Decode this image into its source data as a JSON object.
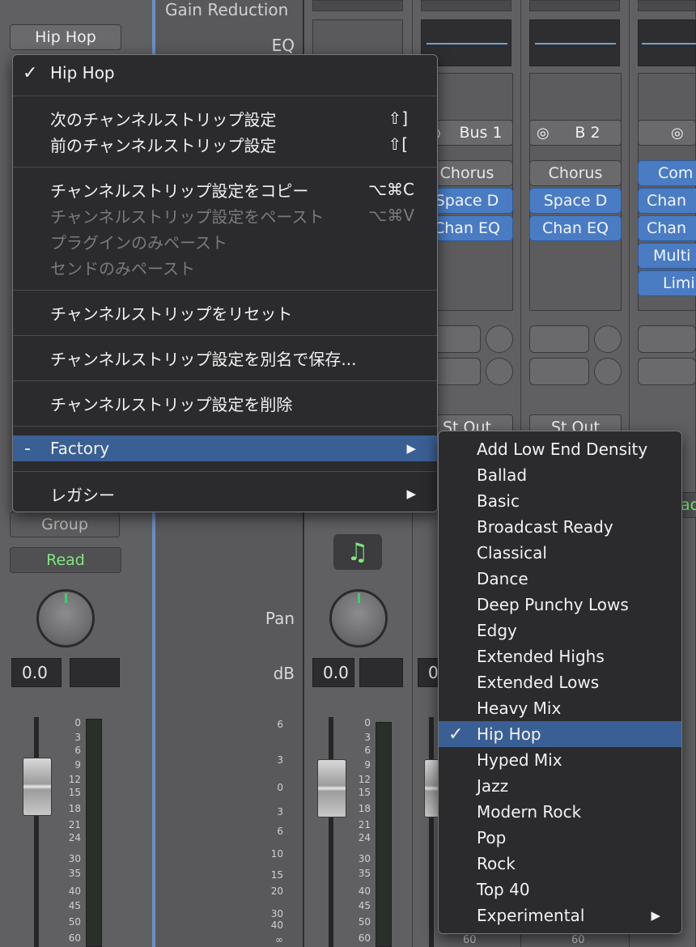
{
  "mixer": {
    "channel_preset": "Hip Hop",
    "labels": {
      "gain_reduction": "Gain Reduction",
      "eq": "EQ",
      "pan": "Pan",
      "db": "dB",
      "group": "Group",
      "read": "Read"
    },
    "strips": [
      {
        "id": "s1",
        "pan_value": "0.0"
      },
      {
        "id": "s2",
        "pan_value": "0.0"
      },
      {
        "id": "s3",
        "pan_value": "0"
      }
    ],
    "io": {
      "bus1": "Bus 1",
      "b2": "B 2",
      "st_out_1": "St Out",
      "st_out_2": "St Out"
    },
    "slots_c1": [
      "Chorus",
      "Space D",
      "Chan EQ"
    ],
    "slots_c2": [
      "Chorus",
      "Space D",
      "Chan EQ"
    ],
    "slots_c3": [
      "Com",
      "Chan",
      "Chan",
      "Multi",
      "Limi"
    ],
    "read_partial": "ad",
    "scale_left": [
      "0",
      "3",
      "6",
      "9",
      "12",
      "15",
      "18",
      "21",
      "24",
      "30",
      "35",
      "40",
      "45",
      "50",
      "60"
    ],
    "scale_mid_left": [
      "6",
      "3",
      "0",
      "3",
      "6",
      "10",
      "15",
      "20",
      "30",
      "40",
      "∞"
    ],
    "scale_mid_right": [
      "0",
      "3",
      "6",
      "9",
      "12",
      "15",
      "18",
      "21",
      "24",
      "30",
      "35",
      "40",
      "45",
      "50",
      "60"
    ],
    "scale_bottom": [
      "60",
      "60"
    ]
  },
  "context_menu": {
    "header": {
      "check": "✓",
      "label": "Hip Hop"
    },
    "items": [
      {
        "label": "次のチャンネルストリップ設定",
        "shortcut": "⇧]"
      },
      {
        "label": "前のチャンネルストリップ設定",
        "shortcut": "⇧["
      },
      {
        "label": "チャンネルストリップ設定をコピー",
        "shortcut": "⌥⌘C"
      },
      {
        "label": "チャンネルストリップ設定をペースト",
        "shortcut": "⌥⌘V",
        "disabled": true
      },
      {
        "label": "プラグインのみペースト",
        "disabled": true
      },
      {
        "label": "センドのみペースト",
        "disabled": true
      },
      {
        "label": "チャンネルストリップをリセット"
      },
      {
        "label": "チャンネルストリップ設定を別名で保存..."
      },
      {
        "label": "チャンネルストリップ設定を削除"
      },
      {
        "label": "Factory",
        "prefix": "-",
        "arrow": "▶",
        "highlighted": true
      },
      {
        "label": "レガシー",
        "arrow": "▶"
      }
    ]
  },
  "factory_submenu": {
    "items": [
      "Add Low End Density",
      "Ballad",
      "Basic",
      "Broadcast Ready",
      "Classical",
      "Dance",
      "Deep Punchy Lows",
      "Edgy",
      "Extended Highs",
      "Extended Lows",
      "Heavy Mix",
      "Hip Hop",
      "Hyped Mix",
      "Jazz",
      "Modern Rock",
      "Pop",
      "Rock",
      "Top 40",
      "Experimental"
    ],
    "selected": "Hip Hop",
    "check": "✓",
    "last_arrow": "▶"
  },
  "colors": {
    "highlight": "#3a5f94",
    "plugin_blue": "#4a7cc4",
    "read_green": "#7ee87e",
    "menu_bg": "#2b2b2d"
  },
  "icons": {
    "music_note": "♫",
    "stereo_link": "◎"
  }
}
